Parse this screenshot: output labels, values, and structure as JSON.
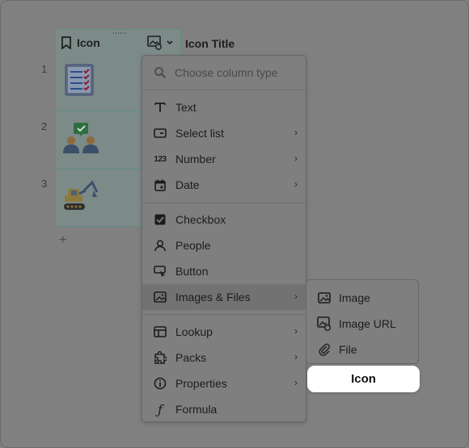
{
  "table": {
    "column1_title": "Icon",
    "column2_title": "Icon Title",
    "rows": [
      {
        "num": "1",
        "icon": "checklist-icon"
      },
      {
        "num": "2",
        "icon": "approved-people-icon"
      },
      {
        "num": "3",
        "icon": "excavator-icon"
      }
    ],
    "add_row": "+"
  },
  "menu": {
    "search_placeholder": "Choose column type",
    "items": [
      {
        "label": "Text",
        "icon": "text-icon"
      },
      {
        "label": "Select list",
        "icon": "select-list-icon"
      },
      {
        "label": "Number",
        "icon": "number-icon",
        "icon_text": "123"
      },
      {
        "label": "Date",
        "icon": "calendar-icon"
      },
      {
        "label": "Checkbox",
        "icon": "checkbox-icon"
      },
      {
        "label": "People",
        "icon": "person-icon"
      },
      {
        "label": "Button",
        "icon": "button-icon"
      },
      {
        "label": "Images & Files",
        "icon": "image-icon"
      },
      {
        "label": "Lookup",
        "icon": "lookup-icon"
      },
      {
        "label": "Packs",
        "icon": "puzzle-icon"
      },
      {
        "label": "Properties",
        "icon": "info-icon"
      },
      {
        "label": "Formula",
        "icon": "formula-icon",
        "icon_text": "ƒ"
      }
    ]
  },
  "submenu": {
    "items": [
      {
        "label": "Image",
        "icon": "image-icon"
      },
      {
        "label": "Image URL",
        "icon": "image-url-icon"
      },
      {
        "label": "File",
        "icon": "paperclip-icon"
      }
    ],
    "highlight_label": "Icon"
  }
}
